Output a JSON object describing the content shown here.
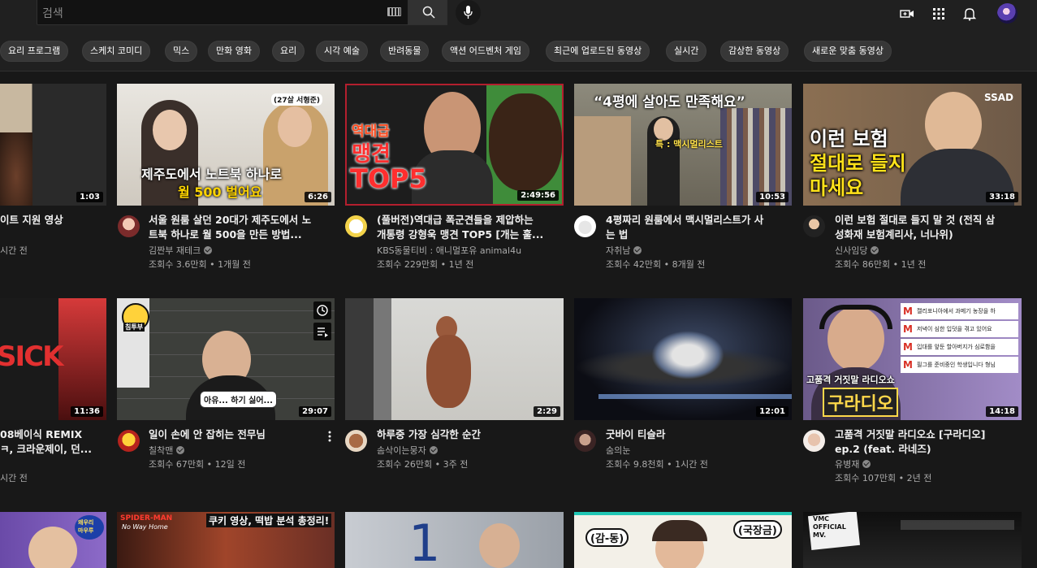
{
  "search": {
    "placeholder": "검색"
  },
  "icons": {
    "search": "search-icon",
    "mic": "mic-icon",
    "create": "create-video-icon",
    "apps": "apps-grid-icon",
    "notifications": "bell-icon",
    "keyboard": "keyboard-icon"
  },
  "chips": [
    "요리 프로그램",
    "스케치 코미디",
    "믹스",
    "만화 영화",
    "요리",
    "시각 예술",
    "반려동물",
    "액션 어드벤처 게임",
    "최근에 업로드된 동영상",
    "실시간",
    "감상한 동영상",
    "새로운 맞춤 동영상"
  ],
  "row1": [
    {
      "title_l1": "이트 지원 영상",
      "title_l2": "",
      "channel": "",
      "views": "시간 전",
      "duration": "1:03"
    },
    {
      "title_l1": "서울 원룸 살던 20대가 제주도에서 노",
      "title_l2": "트북 하나로 월 500을 만든 방법...",
      "channel": "김짠부 재테크",
      "views": "조회수 3.6만회 • 1개월 전",
      "duration": "6:26",
      "overlay": [
        "제주도에서 노트북 하나로",
        "월 500 벌어요",
        "(27살 서형준)"
      ]
    },
    {
      "title_l1": "(풀버전)역대급 폭군견들을 제압하는",
      "title_l2": "개통령 강형욱 맹견 TOP5 [개는 훌...",
      "channel": "KBS동물티비 : 애니멀포유 animal4u",
      "views": "조회수 229만회 • 1년 전",
      "duration": "2:49:56",
      "overlay": [
        "역대급",
        "맹견",
        "TOP5"
      ]
    },
    {
      "title_l1": "4평짜리 원룸에서 맥시멀리스트가 사",
      "title_l2": "는 법",
      "channel": "자취남",
      "views": "조회수 42만회 • 8개월 전",
      "duration": "10:53",
      "overlay": [
        "“4평에 살아도 만족해요”",
        "특 : 맥시멀리스트"
      ]
    },
    {
      "title_l1": "이런 보험 절대로 들지 말 것 (전직 삼",
      "title_l2": "성화재 보험계리사, 너나위)",
      "channel": "신사임당",
      "views": "조회수 86만회 • 1년 전",
      "duration": "33:18",
      "overlay": [
        "이런 보험",
        "절대로 들지",
        "마세요",
        "SSAD"
      ]
    }
  ],
  "row2": [
    {
      "title_l1": "08베이식 REMIX",
      "title_l2": "ㅋ, 크라운제이, 던...",
      "channel": "",
      "views": "시간 전",
      "duration": "11:36",
      "overlay": [
        "SICK"
      ]
    },
    {
      "title_l1": "일이 손에 안 잡히는 전무님",
      "title_l2": "",
      "channel": "칠착맨",
      "views": "조회수 67만회 • 12일 전",
      "duration": "29:07",
      "overlay": [
        "아유... 하기 싫어...",
        "침투부"
      ]
    },
    {
      "title_l1": "하루중 가장 심각한 순간",
      "title_l2": "",
      "channel": "솜삭이는뭉자",
      "views": "조회수 26만회 • 3주 전",
      "duration": "2:29"
    },
    {
      "title_l1": "굿바이 티슬라",
      "title_l2": "",
      "channel": "숨의눈",
      "views": "조회수 9.8천회 • 1시간 전",
      "duration": "12:01"
    },
    {
      "title_l1": "고품격 거짓말 라디오쇼 [구라디오]",
      "title_l2": "ep.2 (feat. 라네즈)",
      "channel": "유병재",
      "views": "조회수 107만회 • 2년 전",
      "duration": "14:18",
      "overlay": [
        "고품격 거짓말 라디오쇼",
        "구라디오",
        "캘리포니아에서 과메기 농장을 하",
        "저녁이 심한 입덧을 겪고 있어요",
        "입대를 앞둔 할아버지가 심로함을",
        "필그를 준비중인 학생입니다 형님"
      ]
    }
  ],
  "row3": [
    {
      "overlay": [
        "왜우리",
        "마우루"
      ]
    },
    {
      "overlay": [
        "쿠키 영상, 떡밥 분석 총정리!",
        "SPIDER-MAN",
        "No Way Home"
      ]
    },
    {
      "overlay": [
        "1"
      ]
    },
    {
      "overlay": [
        "(감-동)",
        "(국장금)"
      ]
    },
    {
      "overlay": [
        "VMC",
        "OFFICIAL",
        "MV."
      ]
    }
  ],
  "colors": {
    "bg": "#181818",
    "topbar": "#202020",
    "chip": "#373737",
    "text_secondary": "#aaa"
  }
}
